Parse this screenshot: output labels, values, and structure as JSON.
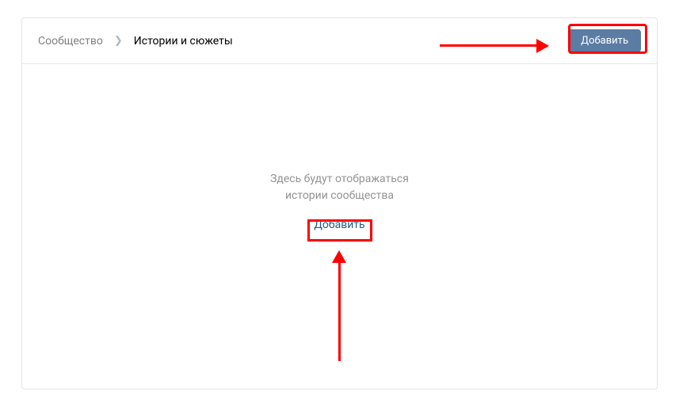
{
  "breadcrumb": {
    "parent": "Сообщество",
    "current": "Истории и сюжеты"
  },
  "header": {
    "add_button": "Добавить"
  },
  "empty": {
    "line1": "Здесь будут отображаться",
    "line2": "истории сообщества",
    "add_link": "Добавить"
  }
}
